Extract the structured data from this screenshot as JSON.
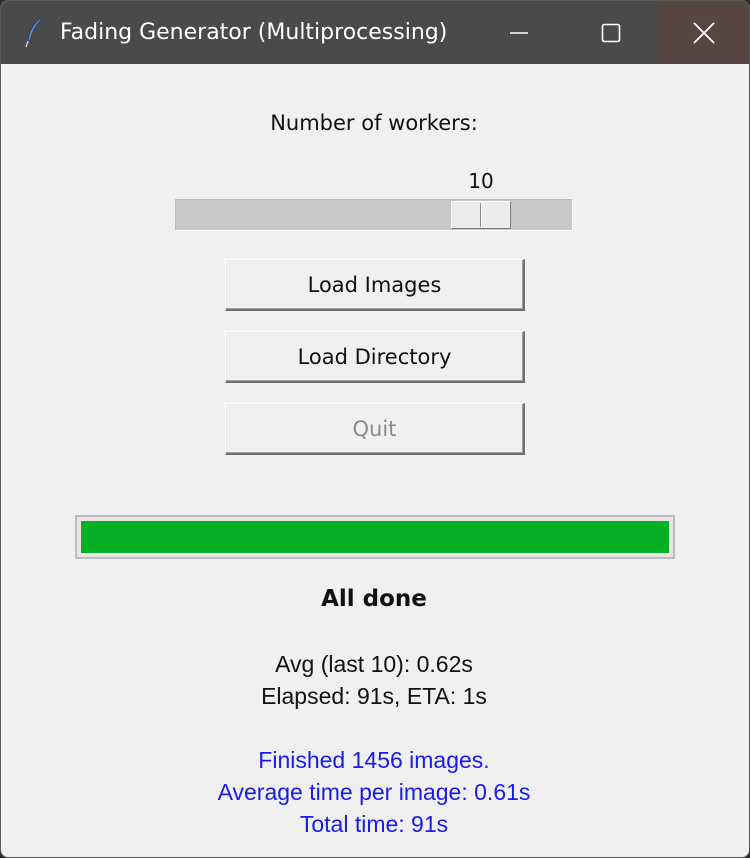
{
  "window": {
    "title": "Fading Generator (Multiprocessing)",
    "icon": "feather-icon"
  },
  "controls": {
    "workers_label": "Number of workers:",
    "workers_value": "10",
    "workers_slider_level": 0.7,
    "load_images_label": "Load Images",
    "load_directory_label": "Load Directory",
    "quit_label": "Quit"
  },
  "progress": {
    "value": 1.0,
    "color": "#06b025"
  },
  "status": {
    "text": "All done",
    "avg_line": "Avg (last 10): 0.62s",
    "elapsed_line": "Elapsed: 91s, ETA: 1s"
  },
  "summary": {
    "color": "#1a1af0",
    "line1": "Finished 1456 images.",
    "line2": "Average time per image: 0.61s",
    "line3": "Total time: 91s"
  }
}
